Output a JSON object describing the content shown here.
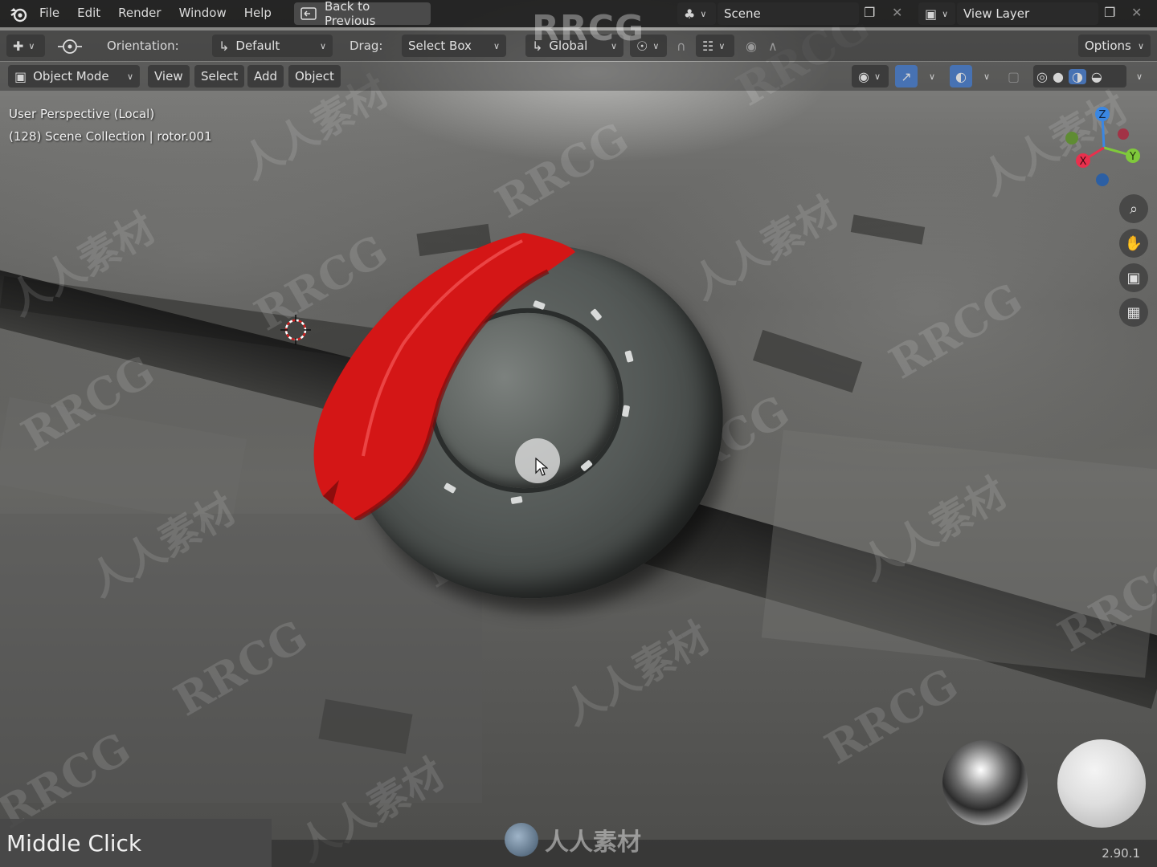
{
  "app": {
    "blender_logo_icon": "blender-icon",
    "menu": [
      "File",
      "Edit",
      "Render",
      "Window",
      "Help"
    ],
    "back_button": "Back to Previous",
    "scene": {
      "label": "Scene"
    },
    "view_layer": {
      "label": "View Layer"
    },
    "version": "2.90.1"
  },
  "toolbar": {
    "orientation_label": "Orientation:",
    "orientation_value": "Default",
    "drag_label": "Drag:",
    "drag_value": "Select Box",
    "transform_orientation": "Global",
    "options_label": "Options"
  },
  "header": {
    "mode": "Object Mode",
    "menus": [
      "View",
      "Select",
      "Add",
      "Object"
    ]
  },
  "viewport": {
    "perspective": "User Perspective (Local)",
    "collection": "(128) Scene Collection | rotor.001",
    "gizmo_axes": [
      "Z",
      "Y",
      "X"
    ],
    "axis_colors": {
      "x": "#e8304d",
      "y": "#7fc93b",
      "z": "#3a87e3"
    },
    "caliper_color": "#d91818"
  },
  "keycast": {
    "text": "Middle Click"
  },
  "watermarks": {
    "top": "RRCG",
    "repeat_latin": "RRCG",
    "repeat_cn": "人人素材",
    "bottom": "人人素材"
  }
}
